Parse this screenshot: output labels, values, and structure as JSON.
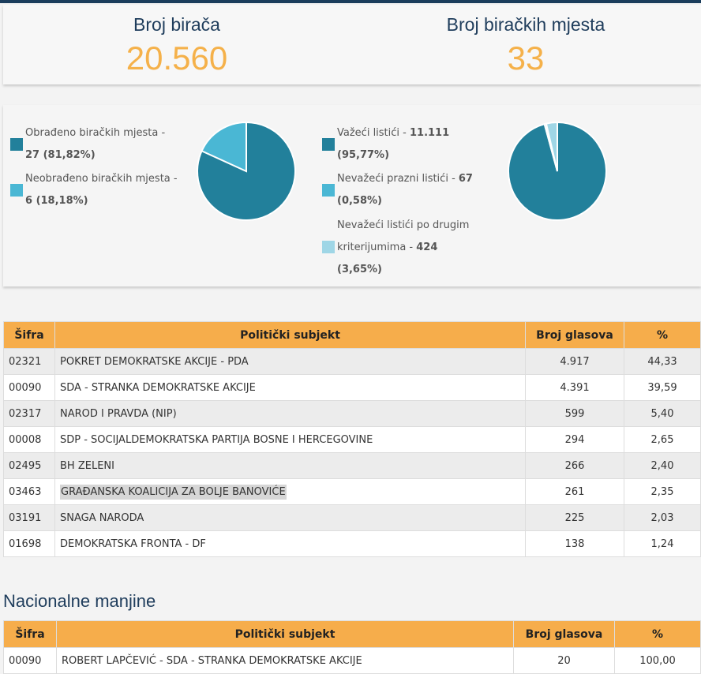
{
  "stats": {
    "voters_label": "Broj birača",
    "voters_value": "20.560",
    "stations_label": "Broj biračkih mjesta",
    "stations_value": "33"
  },
  "colors": {
    "dark_teal": "#22809b",
    "light_blue": "#4ab7d4",
    "pale_blue": "#9fd6e6",
    "orange_header": "#f6ad4b",
    "stat_value": "#f5b14a",
    "title_navy": "#1f3d5c"
  },
  "pie_left": {
    "legend": [
      {
        "text": "Obrađeno biračkih mjesta -",
        "value": "27 (81,82%)",
        "color": "#22809b",
        "fraction": 0.8182
      },
      {
        "text": "Neobrađeno biračkih mjesta -",
        "value": "6 (18,18%)",
        "color": "#4ab7d4",
        "fraction": 0.1818
      }
    ]
  },
  "pie_right": {
    "legend": [
      {
        "text": "Važeći listići - ",
        "value": "11.111",
        "text2": "(95,77%)",
        "color": "#22809b",
        "fraction": 0.9577
      },
      {
        "text": "Nevažeći prazni listići - ",
        "value": "67",
        "text2": "(0,58%)",
        "color": "#4ab7d4",
        "fraction": 0.0058
      },
      {
        "text": "Nevažeći listići po drugim",
        "text_b": "kriterijumima - ",
        "value": "424",
        "text2": "(3,65%)",
        "color": "#9fd6e6",
        "fraction": 0.0365
      }
    ]
  },
  "table_main": {
    "headers": [
      "Šifra",
      "Politički subjekt",
      "Broj glasova",
      "%"
    ],
    "rows": [
      {
        "code": "02321",
        "name": "POKRET DEMOKRATSKE AKCIJE - PDA",
        "votes": "4.917",
        "pct": "44,33"
      },
      {
        "code": "00090",
        "name": "SDA - STRANKA DEMOKRATSKE AKCIJE",
        "votes": "4.391",
        "pct": "39,59"
      },
      {
        "code": "02317",
        "name": "NAROD I PRAVDA (NIP)",
        "votes": "599",
        "pct": "5,40"
      },
      {
        "code": "00008",
        "name": "SDP - SOCIJALDEMOKRATSKA PARTIJA BOSNE I HERCEGOVINE",
        "votes": "294",
        "pct": "2,65"
      },
      {
        "code": "02495",
        "name": "BH ZELENI",
        "votes": "266",
        "pct": "2,40"
      },
      {
        "code": "03463",
        "name": "GRAĐANSKA KOALICIJA ZA BOLJE BANOVIĆE",
        "votes": "261",
        "pct": "2,35"
      },
      {
        "code": "03191",
        "name": "SNAGA NARODA",
        "votes": "225",
        "pct": "2,03"
      },
      {
        "code": "01698",
        "name": "DEMOKRATSKA FRONTA - DF",
        "votes": "138",
        "pct": "1,24"
      }
    ]
  },
  "minorities": {
    "title": "Nacionalne manjine",
    "headers": [
      "Šifra",
      "Politički subjekt",
      "Broj glasova",
      "%"
    ],
    "rows": [
      {
        "code": "00090",
        "name": "ROBERT LAPČEVIĆ - SDA - STRANKA DEMOKRATSKE AKCIJE",
        "votes": "20",
        "pct": "100,00"
      }
    ]
  }
}
